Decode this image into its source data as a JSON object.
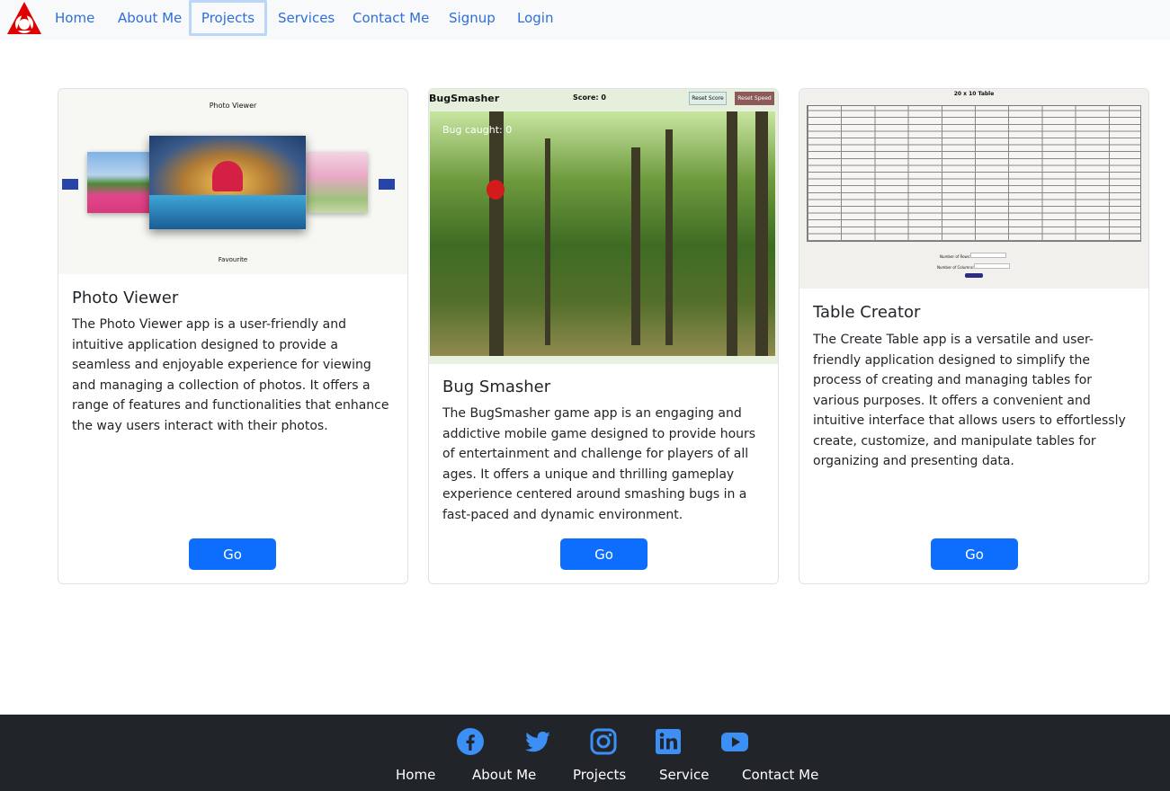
{
  "nav": {
    "items": [
      "Home",
      "About Me",
      "Projects",
      "Services",
      "Contact Me",
      "Signup",
      "Login"
    ],
    "active": "Projects"
  },
  "cards": [
    {
      "title": "Photo Viewer",
      "text": "The Photo Viewer app is a user-friendly and intuitive application designed to provide a seamless and enjoyable experience for viewing and managing a collection of photos. It offers a range of features and functionalities that enhance the way users interact with their photos.",
      "button": "Go",
      "preview": {
        "heading": "Photo Viewer",
        "caption": "Favourite"
      }
    },
    {
      "title": "Bug Smasher",
      "text": "The BugSmasher game app is an engaging and addictive mobile game designed to provide hours of entertainment and challenge for players of all ages. It offers a unique and thrilling gameplay experience centered around smashing bugs in a fast-paced and dynamic environment.",
      "button": "Go",
      "preview": {
        "name": "BugSmasher",
        "score": "Score: 0",
        "reset_score": "Reset Score",
        "reset_speed": "Reset Speed",
        "caught": "Bug caught: 0"
      }
    },
    {
      "title": "Table Creator",
      "text": "The Create Table app is a versatile and user-friendly application designed to simplify the process of creating and managing tables for various purposes. It offers a convenient and intuitive interface that allows users to effortlessly create, customize, and manipulate tables for organizing and presenting data.",
      "button": "Go",
      "preview": {
        "heading": "20 x 10 Table",
        "rows_label": "Number of Rows:",
        "cols_label": "Number of Columns:"
      }
    }
  ],
  "footer": {
    "social": [
      "facebook-icon",
      "twitter-icon",
      "instagram-icon",
      "linkedin-icon",
      "youtube-icon"
    ],
    "links": [
      "Home",
      "About Me",
      "Projects",
      "Service",
      "Contact Me"
    ]
  },
  "colors": {
    "accent": "#0d6efd",
    "nav_link": "#2f6fd8",
    "footer_bg": "#212529",
    "social": "#3c8ff5",
    "logo": "#e00000"
  }
}
